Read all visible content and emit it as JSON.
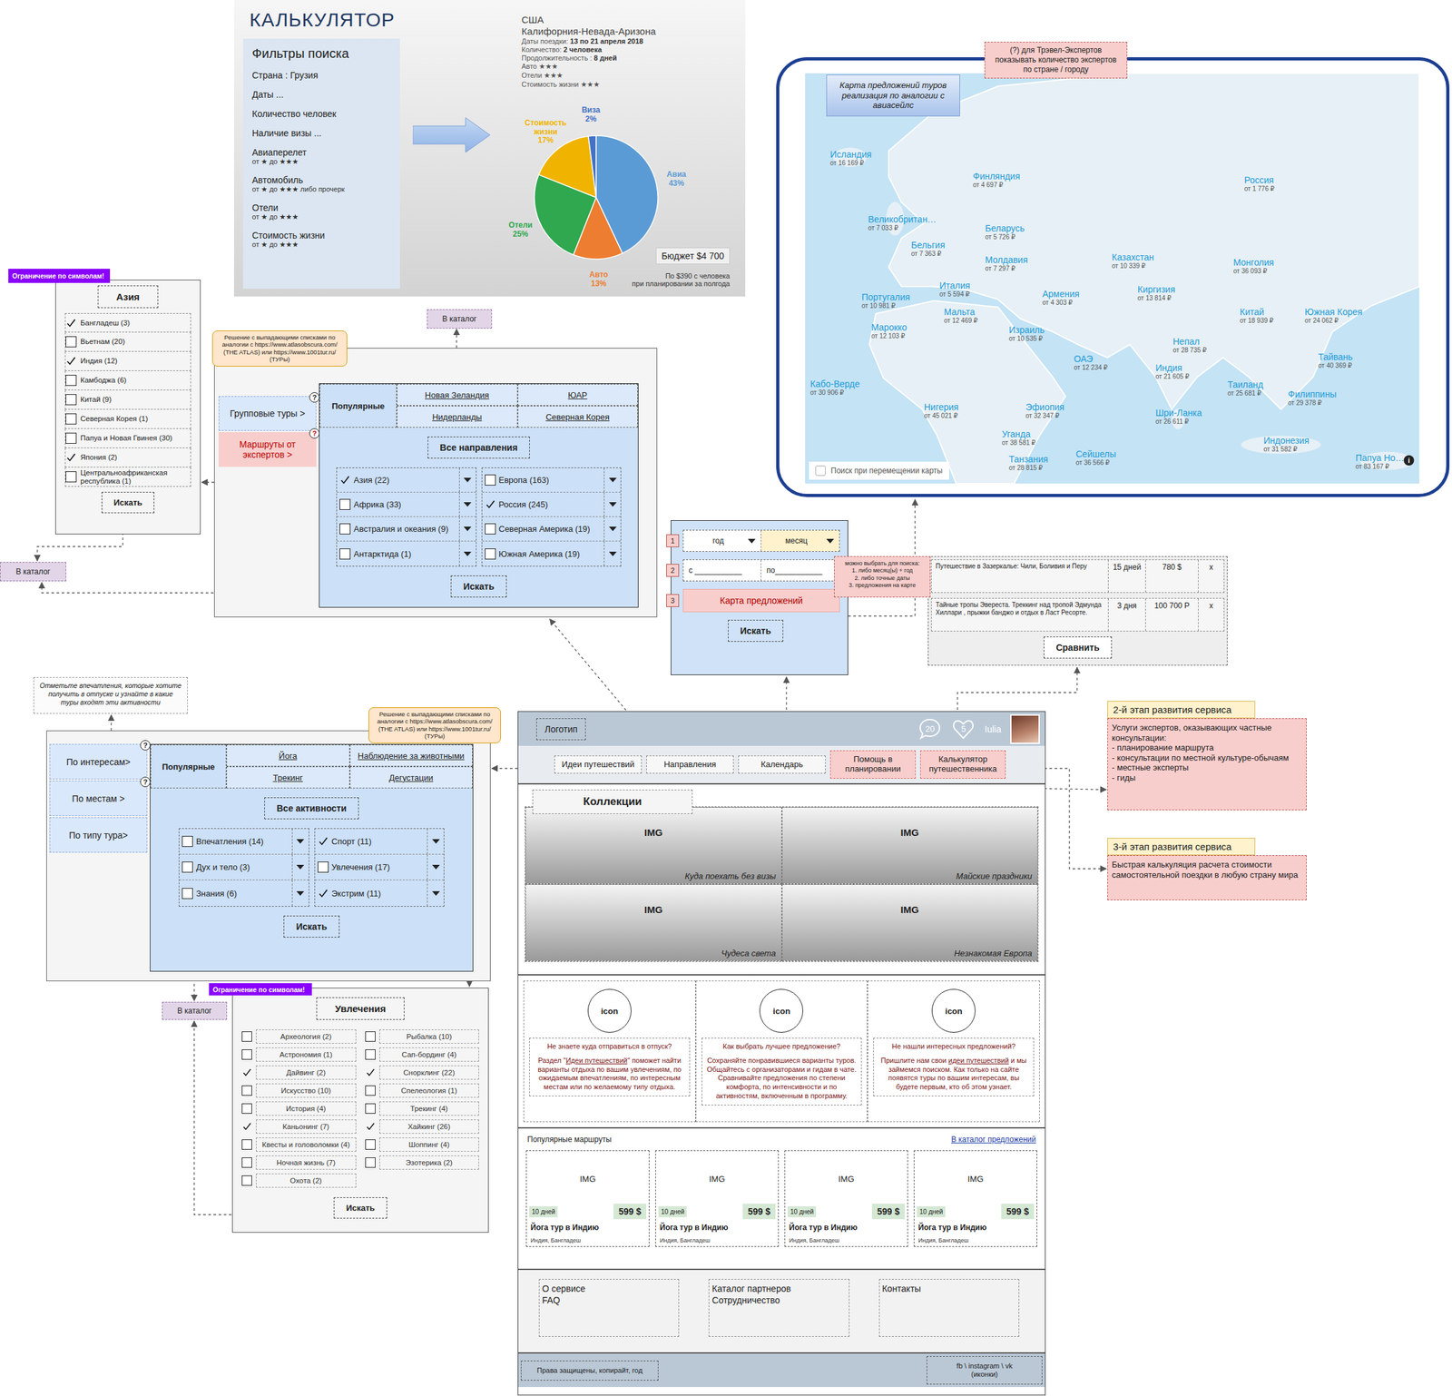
{
  "calculator": {
    "title": "КАЛЬКУЛЯТОР",
    "filters_title": "Фильтры поиска",
    "filters": [
      {
        "label": "Страна : Грузия"
      },
      {
        "label": "Даты ..."
      },
      {
        "label": "Количество человек"
      },
      {
        "label": "Наличие визы ..."
      },
      {
        "label": "Авиаперелет",
        "sub": "от ★ до ★★★"
      },
      {
        "label": "Автомобиль",
        "sub": "от ★ до ★★★ либо прочерк"
      },
      {
        "label": "Отели",
        "sub": "от ★ до ★★★"
      },
      {
        "label": "Стоимость жизни",
        "sub": "от ★ до ★★★"
      }
    ],
    "country": "США",
    "region": "Калифорния-Невада-Аризона",
    "details": [
      {
        "label": "Даты поездки: ",
        "value": "13 по 21 апреля 2018"
      },
      {
        "label": "Количество: ",
        "value": "2 человека"
      },
      {
        "label": "Продолжительность : ",
        "value": "8 дней"
      },
      {
        "label": "Авто ★★★"
      },
      {
        "label": "Отели ★★★"
      },
      {
        "label": "Стоимость жизни ★★★"
      }
    ],
    "chart": {
      "series": [
        {
          "name": "Авиа",
          "value": 43,
          "label": "43%",
          "color": "#5b9bd5"
        },
        {
          "name": "Авто",
          "value": 13,
          "label": "13%",
          "color": "#ed7d31"
        },
        {
          "name": "Отели",
          "value": 25,
          "label": "25%",
          "color": "#2fa84f"
        },
        {
          "name": "Стоимость жизни",
          "value": 17,
          "label": "17%",
          "color": "#f0b400"
        },
        {
          "name": "Виза",
          "value": 2,
          "label": "2%",
          "color": "#4472c4"
        }
      ]
    },
    "budget": "Бюджет $4 700",
    "per_person": [
      "По $390 с человека",
      "при планировании за полгода"
    ]
  },
  "map": {
    "expert_note": "(?) для Трэвел-Экспертов показывать количество экспертов по стране / городу",
    "note": "Карта предложений туров реализация по аналогии с авиасейлс",
    "search_toggle": {
      "label": "Поиск при перемещении карты",
      "checked": false
    },
    "info": "i",
    "pins": [
      {
        "name": "Исландия",
        "price": "от 16 169 ₽"
      },
      {
        "name": "Финляндия",
        "price": "от 4 697 ₽"
      },
      {
        "name": "Россия",
        "price": "от 1 776 ₽"
      },
      {
        "name": "Великобритан…",
        "price": "от 7 033 ₽"
      },
      {
        "name": "Беларусь",
        "price": "от 5 726 ₽"
      },
      {
        "name": "Бельгия",
        "price": "от 7 363 ₽"
      },
      {
        "name": "Молдавия",
        "price": "от 7 297 ₽"
      },
      {
        "name": "Казахстан",
        "price": "от 10 339 ₽"
      },
      {
        "name": "Монголия",
        "price": "от 36 093 ₽"
      },
      {
        "name": "Италия",
        "price": "от 5 594 ₽"
      },
      {
        "name": "Армения",
        "price": "от 4 303 ₽"
      },
      {
        "name": "Киргизия",
        "price": "от 13 814 ₽"
      },
      {
        "name": "Португалия",
        "price": "от 10 981 ₽"
      },
      {
        "name": "Мальта",
        "price": "от 12 469 ₽"
      },
      {
        "name": "Китай",
        "price": "от 18 939 ₽"
      },
      {
        "name": "Южная Корея",
        "price": "от 24 062 ₽"
      },
      {
        "name": "Марокко",
        "price": "от 12 103 ₽"
      },
      {
        "name": "Израиль",
        "price": "от 10 535 ₽"
      },
      {
        "name": "Непал",
        "price": "от 28 735 ₽"
      },
      {
        "name": "ОАЭ",
        "price": "от 12 234 ₽"
      },
      {
        "name": "Индия",
        "price": "от 21 605 ₽"
      },
      {
        "name": "Тайвань",
        "price": "от 40 369 ₽"
      },
      {
        "name": "Кабо-Верде",
        "price": "от 30 906 ₽"
      },
      {
        "name": "Таиланд",
        "price": "от 25 681 ₽"
      },
      {
        "name": "Филиппины",
        "price": "от 29 378 ₽"
      },
      {
        "name": "Нигерия",
        "price": "от 45 021 ₽"
      },
      {
        "name": "Эфиопия",
        "price": "от 32 347 ₽"
      },
      {
        "name": "Шри-Ланка",
        "price": "от 26 611 ₽"
      },
      {
        "name": "Уганда",
        "price": "от 38 581 ₽"
      },
      {
        "name": "Индонезия",
        "price": "от 31 582 ₽"
      },
      {
        "name": "Танзания",
        "price": "от 28 815 ₽"
      },
      {
        "name": "Сейшелы",
        "price": "от 36 566 ₽"
      },
      {
        "name": "Папуа Но…",
        "price": "от 83 167 ₽"
      }
    ]
  },
  "asia_panel": {
    "badge": "Ограничение по символам!",
    "title": "Азия",
    "items": [
      {
        "label": "Бангладеш (3)",
        "checked": true
      },
      {
        "label": "Вьетнам (20)",
        "checked": false
      },
      {
        "label": "Индия (12)",
        "checked": true
      },
      {
        "label": "Камбоджа (6)",
        "checked": false
      },
      {
        "label": "Китай (9)",
        "checked": false
      },
      {
        "label": "Северная Корея (1)",
        "checked": false
      },
      {
        "label": "Папуа и Новая Гвинея (30)",
        "checked": false
      },
      {
        "label": "Япония (2)",
        "checked": true
      },
      {
        "label": "Центральноафриканская республика (1)",
        "checked": false
      }
    ],
    "search": "Искать",
    "catalog": "В каталог"
  },
  "directions_panel": {
    "note": "Решение с выпадающими списками по аналогии с https://www.atlasobscura.com/ (THE ATLAS) или https://www.1001tur.ru/ (ТУРы)",
    "catalog": "В каталог",
    "side": [
      {
        "label": "Групповые туры >",
        "help": "?",
        "kind": "group"
      },
      {
        "label": "Маршруты от экспертов >",
        "help": "?",
        "kind": "expert"
      }
    ],
    "tabs": [
      {
        "label": "Популярные",
        "selected": true
      },
      {
        "label": "Новая Зеландия",
        "selected": false
      },
      {
        "label": "ЮАР",
        "selected": false
      },
      {
        "label": "Нидерланды",
        "selected": false
      },
      {
        "label": "Северная Корея",
        "selected": false
      }
    ],
    "all": "Все направления",
    "columns": [
      [
        {
          "label": "Азия (22)",
          "checked": true
        },
        {
          "label": "Африка (33)",
          "checked": false
        },
        {
          "label": "Австралия и океания (9)",
          "checked": false
        },
        {
          "label": "Антарктида (1)",
          "checked": false
        }
      ],
      [
        {
          "label": "Европа (163)",
          "checked": false
        },
        {
          "label": "Россия (245)",
          "checked": true
        },
        {
          "label": "Северная Америка (19)",
          "checked": false
        },
        {
          "label": "Южная Америка (19)",
          "checked": false
        }
      ]
    ],
    "search": "Искать"
  },
  "calendar_panel": {
    "steps": [
      "1",
      "2",
      "3"
    ],
    "year": "год",
    "month": "месяц",
    "from": "с ___________",
    "to": "по___________",
    "map_button": "Карта предложений",
    "search": "Искать",
    "note": [
      "можно выбрать для поиска:",
      "1. либо месяц(ы) + год",
      "2. либо точные даты",
      "3. предложения на карте"
    ]
  },
  "compare_panel": {
    "rows": [
      {
        "title": "Путешествие в Зазеркалье: Чили, Боливия и Перу",
        "duration": "15 дней",
        "price": "780 $",
        "remove": "x"
      },
      {
        "title": "Тайные тропы Эвереста. Треккинг над тропой Эдмунда Хиллари , прыжки банджо и отдых в Ласт Ресорте.",
        "duration": "3 дня",
        "price": "100 700 Р",
        "remove": "x"
      }
    ],
    "button": "Сравнить"
  },
  "interests_panel": {
    "hint": "Отметьте впечатления, которые хотите получить в отпуске и узнайте в какие туры входят эти активности",
    "note": "Решение с выпадающими списками по аналогии с https://www.atlasobscura.com/ (THE ATLAS) или https://www.1001tur.ru/ (ТУРы)",
    "side": [
      {
        "label": "По интересам>",
        "help": "?"
      },
      {
        "label": "По местам >",
        "help": "?"
      },
      {
        "label": "По типу тура>"
      }
    ],
    "tabs": [
      {
        "label": "Популярные",
        "selected": true
      },
      {
        "label": "Йога",
        "selected": false
      },
      {
        "label": "Наблюдение за животными",
        "selected": false
      },
      {
        "label": "Трекинг",
        "selected": false
      },
      {
        "label": "Дегустации",
        "selected": false
      }
    ],
    "all": "Все активности",
    "columns": [
      [
        {
          "label": "Впечатления (14)",
          "checked": false
        },
        {
          "label": "Дух и тело (3)",
          "checked": false
        },
        {
          "label": "Знания (6)",
          "checked": false
        }
      ],
      [
        {
          "label": "Спорт (11)",
          "checked": true
        },
        {
          "label": "Увлечения (17)",
          "checked": false
        },
        {
          "label": "Экстрим (11)",
          "checked": true
        }
      ]
    ],
    "search": "Искать"
  },
  "hobbies_panel": {
    "badge": "Ограничение по символам!",
    "catalog": "В каталог",
    "title": "Увлечения",
    "columns": [
      [
        {
          "label": "Археология (2)",
          "checked": false
        },
        {
          "label": "Астрономия (1)",
          "checked": false
        },
        {
          "label": "Дайвинг (2)",
          "checked": true
        },
        {
          "label": "Искусство (10)",
          "checked": false
        },
        {
          "label": "История (4)",
          "checked": false
        },
        {
          "label": "Каньонинг (7)",
          "checked": true
        },
        {
          "label": "Квесты и головоломки (4)",
          "checked": false
        },
        {
          "label": "Ночная жизнь (7)",
          "checked": false
        },
        {
          "label": "Охота (2)",
          "checked": false
        }
      ],
      [
        {
          "label": "Рыбалка (10)",
          "checked": false
        },
        {
          "label": "Сап-бординг (4)",
          "checked": false
        },
        {
          "label": "Снорклинг (22)",
          "checked": true
        },
        {
          "label": "Спелеология (1)",
          "checked": false
        },
        {
          "label": "Трекинг (4)",
          "checked": false
        },
        {
          "label": "Хайкинг (26)",
          "checked": true
        },
        {
          "label": "Шоппинг (4)",
          "checked": false
        },
        {
          "label": "Эзотерика (2)",
          "checked": false
        }
      ]
    ],
    "search": "Искать"
  },
  "main_page": {
    "logo": "Логотип",
    "messages": "20",
    "favorites": "5",
    "user": "Iulia",
    "nav": [
      {
        "label": "Идеи путешествий",
        "kind": "link"
      },
      {
        "label": "Направления",
        "kind": "link"
      },
      {
        "label": "Календарь",
        "kind": "link"
      },
      {
        "label": "Помощь в планировании",
        "kind": "highlight"
      },
      {
        "label": "Калькулятор путешественника",
        "kind": "highlight"
      }
    ],
    "collections_title": "Коллекции",
    "collections": [
      {
        "img": "IMG",
        "caption": "Куда поехать без визы"
      },
      {
        "img": "IMG",
        "caption": "Майские праздники"
      },
      {
        "img": "IMG",
        "caption": "Чудеса света"
      },
      {
        "img": "IMG",
        "caption": "Незнакомая Европа"
      }
    ],
    "features": [
      {
        "icon": "icon",
        "question": "Не знаете куда отправиться в отпуск?",
        "before": "Раздел \"",
        "link": "Идеи путешествий",
        "after": "\" поможет найти варианты отдыха по вашим увлечениям, по ожидаемым впечатлениям, по интересным местам или по желаемому типу отдыха."
      },
      {
        "icon": "icon",
        "question": "Как выбрать лучшее предложение?",
        "before": "Сохраняйте понравившиеся варианты туров. Общайтесь с организаторами и гидам в чате. Сравнивайте предложения по степени комфорта, по интенсивности и по активностям, включенным в программу."
      },
      {
        "icon": "icon",
        "question": "Не нашли интересных предложений?",
        "before": "Пришлите нам свои ",
        "link": "идеи путешествий",
        "after": " и мы займемся поиском. Как только на сайте появятся туры по вашим интересам, вы будете первым, кто об этом узнает."
      }
    ],
    "routes_title": "Популярные маршруты",
    "routes_link": "В каталог предложений",
    "routes": [
      {
        "img": "IMG",
        "days": "10 дней",
        "price": "599 $",
        "title": "Йога тур в Индию",
        "place": "Индия, Бангладеш"
      },
      {
        "img": "IMG",
        "days": "10 дней",
        "price": "599 $",
        "title": "Йога тур в Индию",
        "place": "Индия, Бангладеш"
      },
      {
        "img": "IMG",
        "days": "10 дней",
        "price": "599 $",
        "title": "Йога тур в Индию",
        "place": "Индия, Бангладеш"
      },
      {
        "img": "IMG",
        "days": "10 дней",
        "price": "599 $",
        "title": "Йога тур в Индию",
        "place": "Индия, Бангладеш"
      }
    ],
    "footer": [
      [
        "О сервисе",
        "FAQ"
      ],
      [
        "Каталог партнеров",
        "Сотрудничество"
      ],
      [
        "Контакты"
      ]
    ],
    "copyright": "Права защищены, копирайт, год",
    "social": "fb \\ instagram \\ vk (иконки)"
  },
  "stage2": {
    "title": "2-й этап развития сервиса",
    "lines": [
      "Услуги экспертов, оказывающих частные консультации:",
      "- планирование маршрута",
      "- консультации по местной культуре-обычаям",
      "- местные эксперты",
      "- гиды"
    ]
  },
  "stage3": {
    "title": "3-й этап развития сервиса",
    "lines": [
      "Быстрая калькуляция расчета стоимости самостоятельной поездки в любую страну мира"
    ]
  }
}
